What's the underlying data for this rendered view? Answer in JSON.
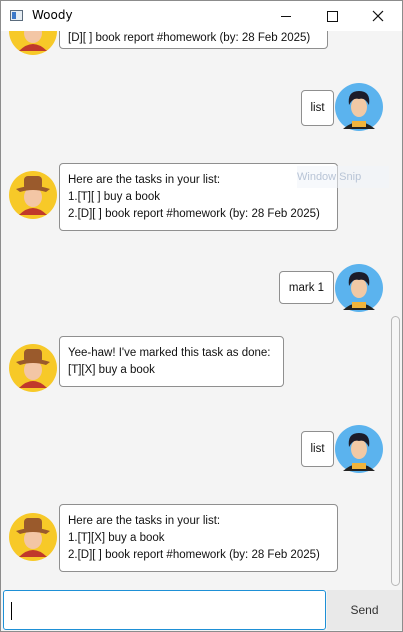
{
  "window": {
    "title": "Woody"
  },
  "ghost_overlay": "Window Snip",
  "messages": [
    {
      "sender": "bot",
      "lines": [
        "[D][ ] book report #homework (by: 28 Feb 2025)"
      ]
    },
    {
      "sender": "user",
      "lines": [
        "list"
      ]
    },
    {
      "sender": "bot",
      "lines": [
        "Here are the tasks in your list:",
        "1.[T][ ] buy a book",
        "2.[D][ ] book report #homework (by: 28 Feb 2025)"
      ]
    },
    {
      "sender": "user",
      "lines": [
        "mark 1"
      ]
    },
    {
      "sender": "bot",
      "lines": [
        "Yee-haw! I've marked this task as done:",
        "[T][X] buy a book"
      ]
    },
    {
      "sender": "user",
      "lines": [
        "list"
      ]
    },
    {
      "sender": "bot",
      "lines": [
        "Here are the tasks in your list:",
        "1.[T][X] buy a book",
        "2.[D][ ] book report #homework (by: 28 Feb 2025)"
      ]
    }
  ],
  "input": {
    "value": "",
    "placeholder": ""
  },
  "send_button": {
    "label": "Send"
  },
  "colors": {
    "input_focus": "#1e90d6",
    "user_avatar_bg": "#5bb3ee",
    "bot_avatar_bg": "#f7c928",
    "bot_hat": "#9a5a2c"
  }
}
